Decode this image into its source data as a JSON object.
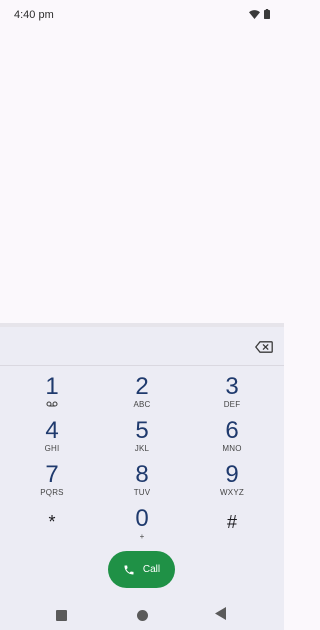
{
  "status_bar": {
    "time": "4:40 pm",
    "icons": [
      "wifi-icon",
      "battery-icon"
    ]
  },
  "dialer": {
    "digits": "",
    "keys": [
      {
        "number": "1",
        "letters": "",
        "voicemail": true
      },
      {
        "number": "2",
        "letters": "ABC"
      },
      {
        "number": "3",
        "letters": "DEF"
      },
      {
        "number": "4",
        "letters": "GHI"
      },
      {
        "number": "5",
        "letters": "JKL"
      },
      {
        "number": "6",
        "letters": "MNO"
      },
      {
        "number": "7",
        "letters": "PQRS"
      },
      {
        "number": "8",
        "letters": "TUV"
      },
      {
        "number": "9",
        "letters": "WXYZ"
      },
      {
        "number": "*",
        "letters": ""
      },
      {
        "number": "0",
        "letters": "+"
      },
      {
        "number": "#",
        "letters": ""
      }
    ],
    "call_label": "Call"
  },
  "colors": {
    "digit": "#1f3a6d",
    "call_button": "#1f9146",
    "pad_background": "#ececf4",
    "screen_background": "#fbf8fc"
  },
  "nav_bar": {
    "buttons": [
      "recents-square-icon",
      "home-circle-icon",
      "back-triangle-icon"
    ]
  }
}
